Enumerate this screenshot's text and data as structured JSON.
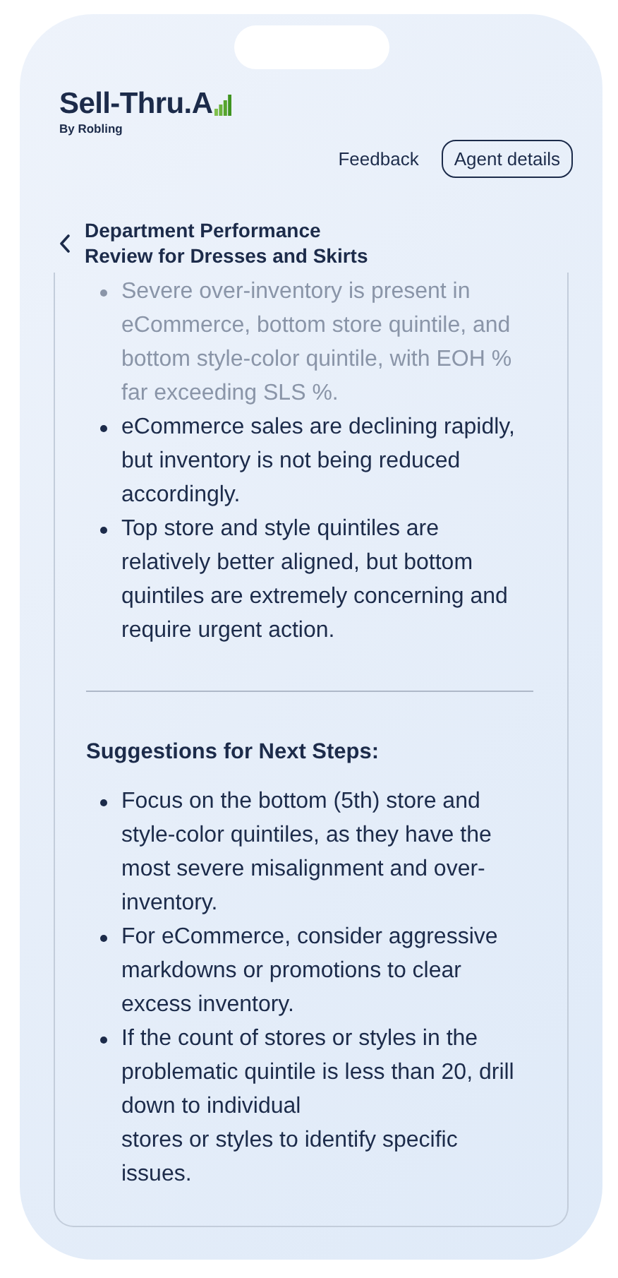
{
  "brand": {
    "name": "Sell-Thru.A",
    "byline": "By Robling"
  },
  "header_actions": [
    {
      "kind": "link",
      "label": "Feedback"
    },
    {
      "kind": "outlined",
      "label": "Agent details"
    }
  ],
  "page_title": "Department Performance\nReview for Dresses and Skirts",
  "sections": [
    {
      "kind": "bullets",
      "items": [
        "Severe over-inventory is present in eCommerce, bottom store quintile, and bottom style-color quintile, with EOH % far exceeding SLS %.",
        "eCommerce sales are declining rapidly, but inventory is not being reduced accordingly.",
        "Top store and style quintiles are relatively better aligned, but bottom quintiles are extremely concerning and require urgent action."
      ]
    },
    {
      "kind": "divider"
    },
    {
      "kind": "heading",
      "text": "Suggestions for Next Steps:"
    },
    {
      "kind": "bullets",
      "items": [
        "Focus on the bottom (5th) store and style-color quintiles, as they have the most severe misalignment and over-inventory.",
        "For eCommerce, consider aggressive markdowns or promotions to clear excess inventory.",
        "If the count of stores or styles in the problematic quintile is less than 20, drill down to individual\nstores or styles to identify specific issues."
      ]
    }
  ]
}
